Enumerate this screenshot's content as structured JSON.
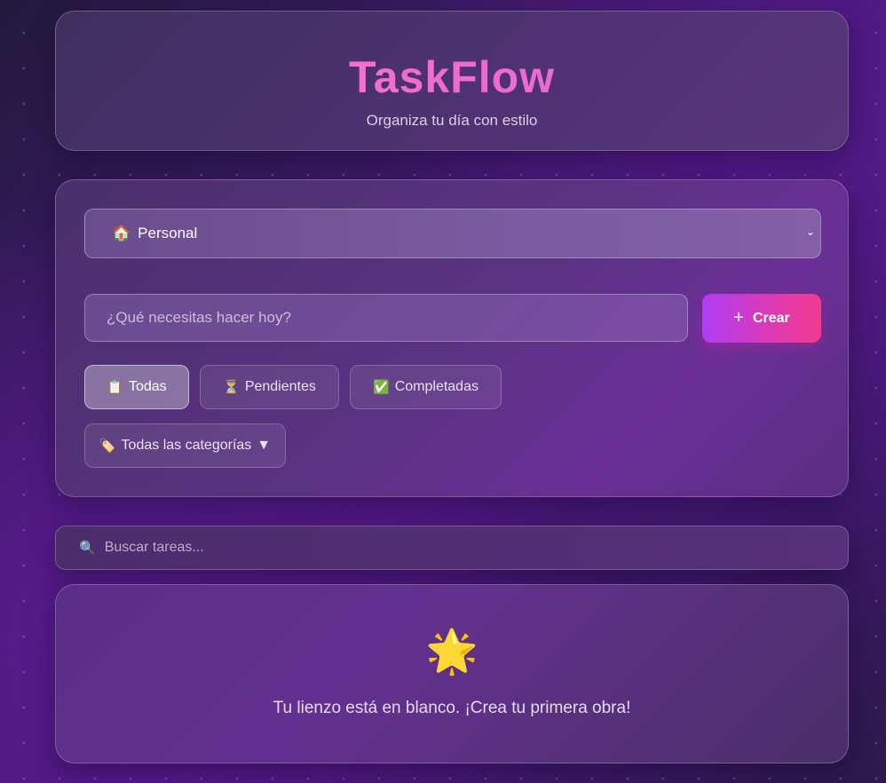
{
  "app": {
    "title": "TaskFlow",
    "subtitle": "Organiza tu día con estilo"
  },
  "form": {
    "category_select": {
      "emoji": "🏠",
      "value": "Personal",
      "icon": "chevron-down-icon"
    },
    "task_input": {
      "placeholder": "¿Qué necesitas hacer hoy?",
      "value": ""
    },
    "create_button": {
      "icon": "plus-icon",
      "label": "Crear"
    }
  },
  "filters": [
    {
      "emoji": "📋",
      "label": "Todas",
      "active": true
    },
    {
      "emoji": "⏳",
      "label": "Pendientes",
      "active": false
    },
    {
      "emoji": "✅",
      "label": "Completadas",
      "active": false
    }
  ],
  "category_filter": {
    "emoji": "🏷️",
    "label": "Todas las categorías",
    "arrow": "▼"
  },
  "search": {
    "icon": "🔍",
    "placeholder": "Buscar tareas..."
  },
  "empty_state": {
    "emoji": "🌟",
    "message": "Tu lienzo está en blanco. ¡Crea tu primera obra!"
  },
  "colors": {
    "title_gradient": [
      "#ff7ec6",
      "#d86ae0"
    ],
    "create_button_gradient": [
      "#b03cf6",
      "#f13a90"
    ]
  }
}
